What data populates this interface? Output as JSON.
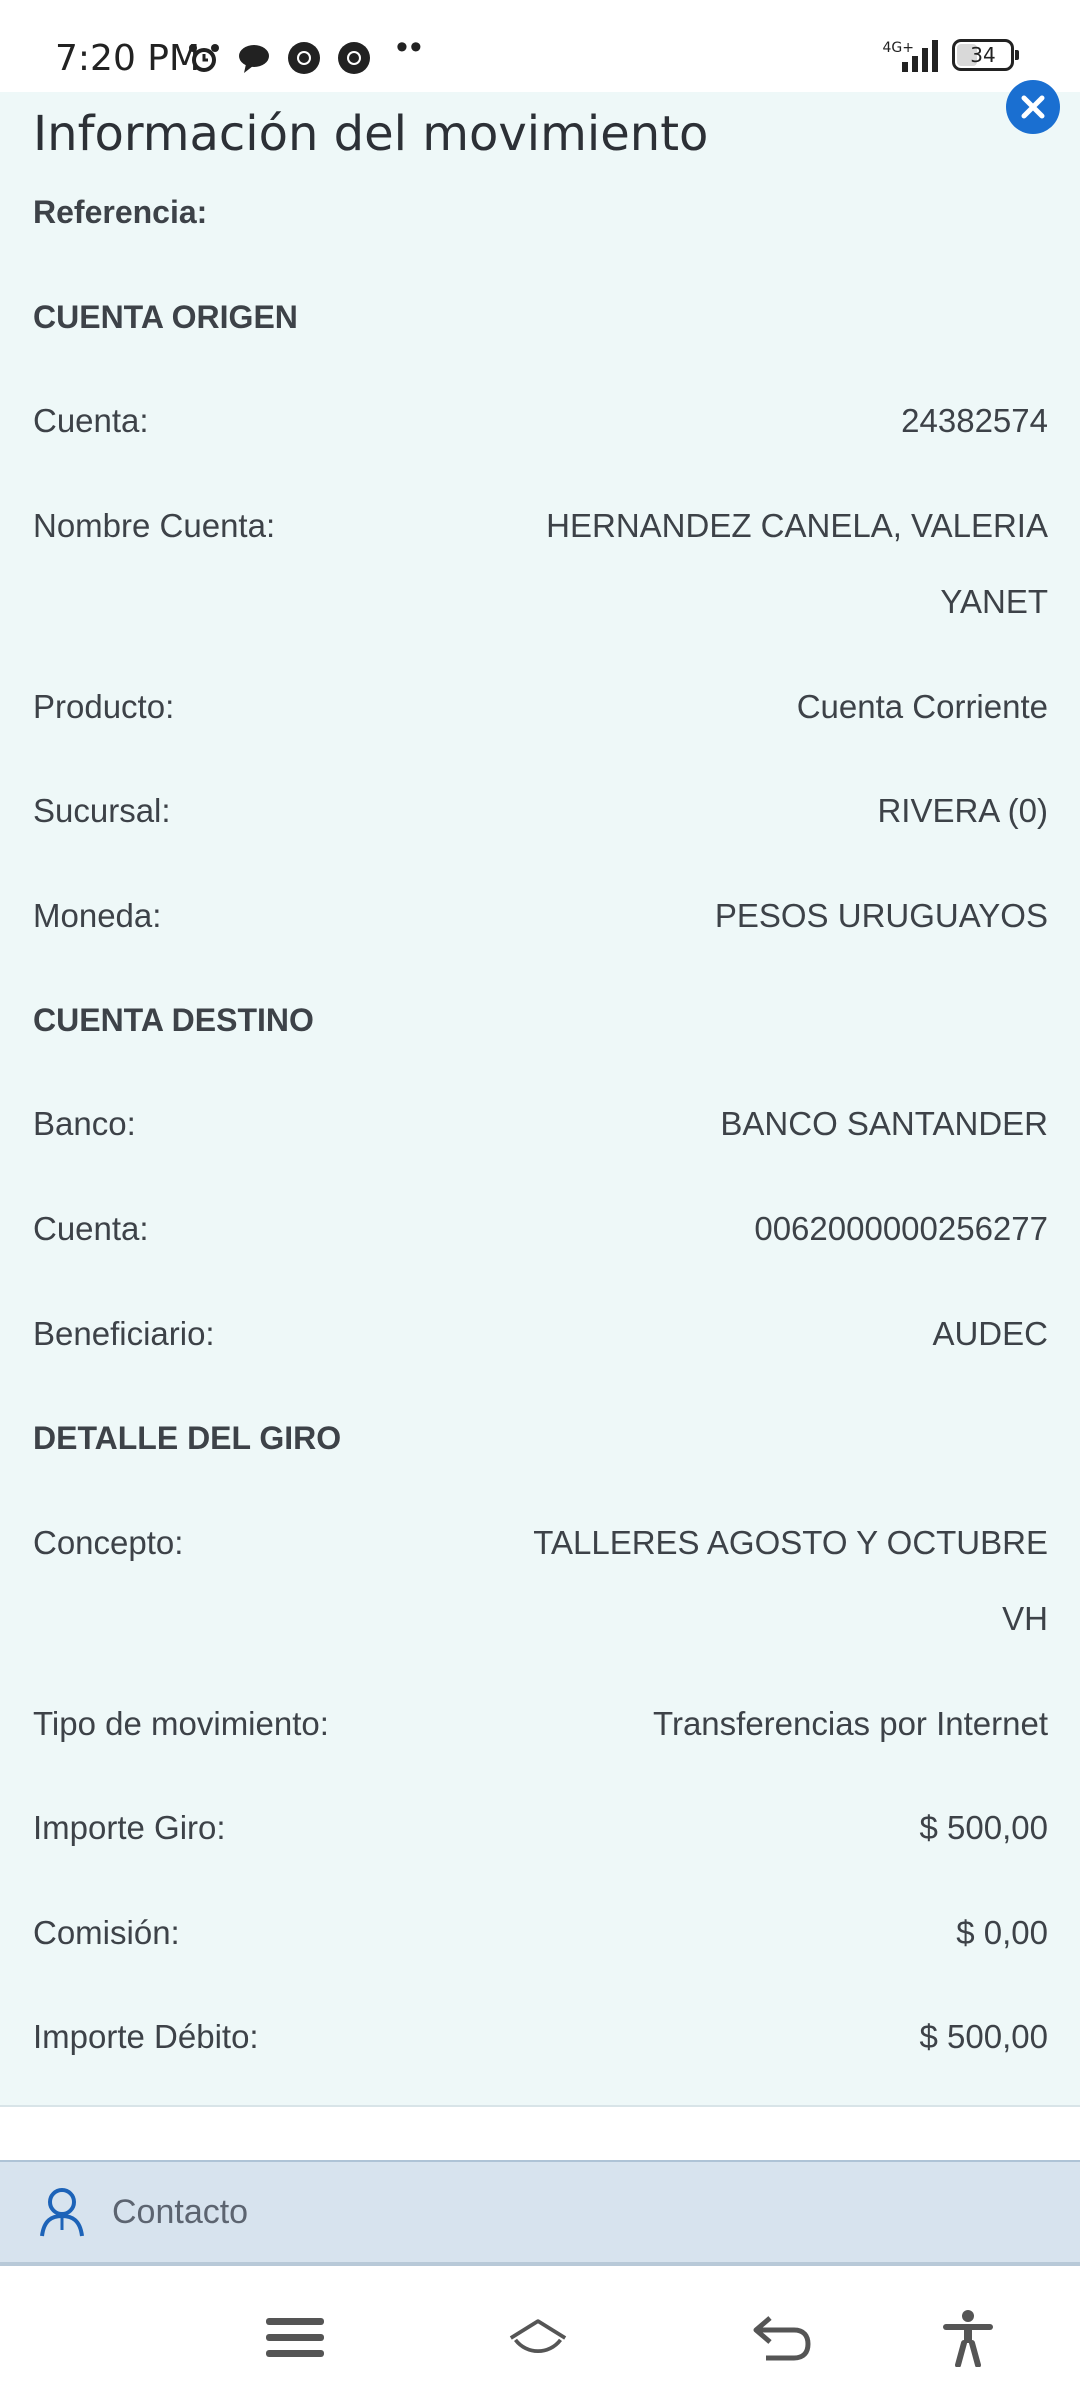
{
  "status_bar": {
    "time": "7:20 PM",
    "dots": "••",
    "network": "4G+",
    "battery": "34"
  },
  "panel": {
    "title": "Información del movimiento",
    "reference_label": "Referencia:",
    "sections": {
      "origin": "CUENTA ORIGEN",
      "destination": "CUENTA DESTINO",
      "detail": "DETALLE DEL GIRO"
    },
    "origin": {
      "cuenta_label": "Cuenta:",
      "cuenta_value": "24382574",
      "nombre_label": "Nombre Cuenta:",
      "nombre_value_1": "HERNANDEZ CANELA, VALERIA",
      "nombre_value_2": "YANET",
      "producto_label": "Producto:",
      "producto_value": "Cuenta Corriente",
      "sucursal_label": "Sucursal:",
      "sucursal_value": "RIVERA (0)",
      "moneda_label": "Moneda:",
      "moneda_value": "PESOS URUGUAYOS"
    },
    "destination": {
      "banco_label": "Banco:",
      "banco_value": "BANCO SANTANDER",
      "cuenta_label": "Cuenta:",
      "cuenta_value": "0062000000256277",
      "beneficiario_label": "Beneficiario:",
      "beneficiario_value": "AUDEC"
    },
    "detail": {
      "concepto_label": "Concepto:",
      "concepto_value_1": "TALLERES AGOSTO Y OCTUBRE",
      "concepto_value_2": "VH",
      "tipo_label": "Tipo de movimiento:",
      "tipo_value": "Transferencias por Internet",
      "importe_giro_label": "Importe Giro:",
      "importe_giro_value": "$ 500,00",
      "comision_label": "Comisión:",
      "comision_value": "$ 0,00",
      "importe_debito_label": "Importe Débito:",
      "importe_debito_value": "$ 500,00"
    }
  },
  "contact": {
    "label": "Contacto"
  },
  "colors": {
    "panel_bg": "#eef8f8",
    "close_button": "#1a6fd1",
    "contact_bar": "#d7e3ee"
  },
  "icons": {
    "close": "close-icon",
    "contact": "person-icon",
    "menu": "menu-icon",
    "home": "home-icon",
    "back": "back-icon",
    "accessibility": "accessibility-icon"
  }
}
